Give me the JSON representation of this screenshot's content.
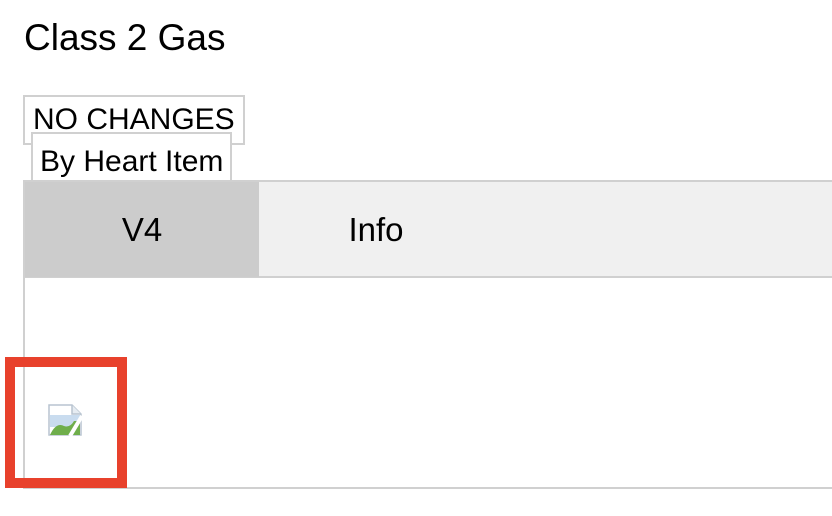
{
  "page": {
    "title": "Class 2 Gas",
    "status": "NO CHANGES"
  },
  "tabs": [
    {
      "label": "V4",
      "active": true
    },
    {
      "label": "Info",
      "active": false
    }
  ],
  "content": {
    "item_label": "By Heart Item",
    "image_icon": "broken-image-icon"
  },
  "highlight": {
    "color": "#e8412c"
  }
}
